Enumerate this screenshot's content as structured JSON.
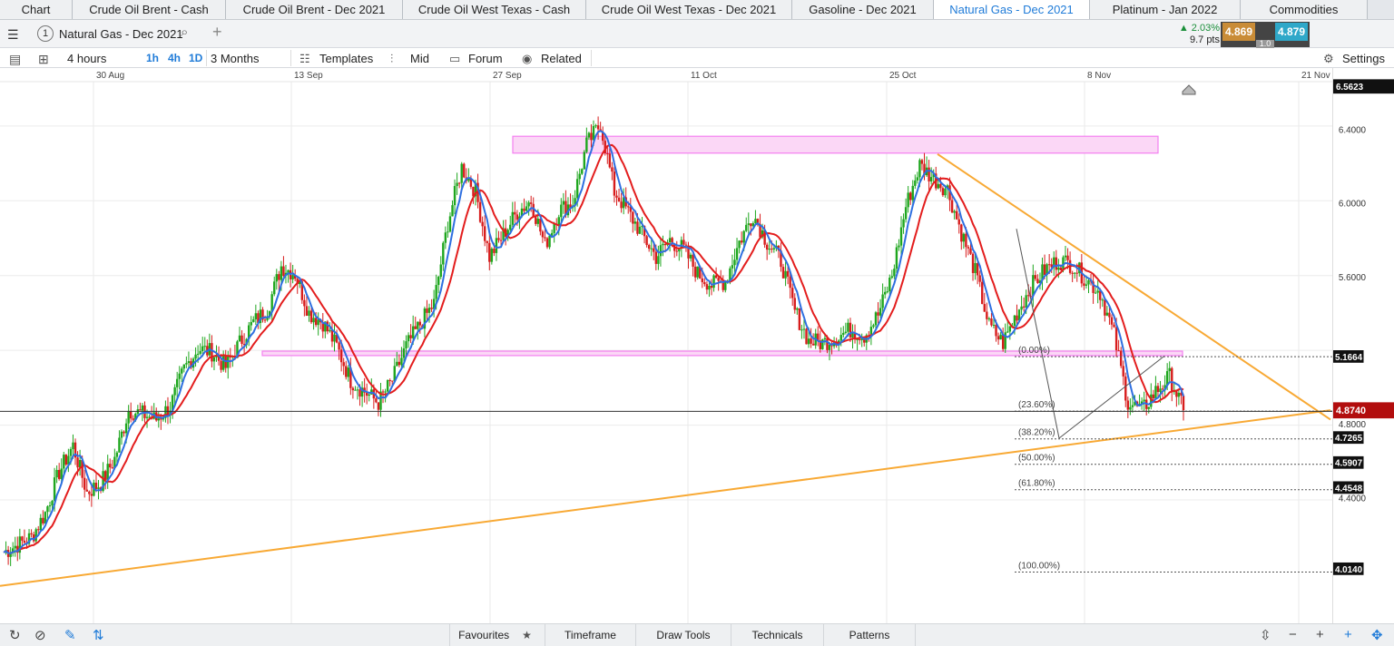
{
  "tabs": [
    {
      "label": "Chart",
      "active": false
    },
    {
      "label": "Crude Oil Brent - Cash",
      "active": false
    },
    {
      "label": "Crude Oil Brent - Dec 2021",
      "active": false
    },
    {
      "label": "Crude Oil West Texas - Cash",
      "active": false
    },
    {
      "label": "Crude Oil West Texas - Dec 2021",
      "active": false
    },
    {
      "label": "Gasoline - Dec 2021",
      "active": false
    },
    {
      "label": "Natural Gas - Dec 2021",
      "active": true
    },
    {
      "label": "Platinum - Jan 2022",
      "active": false
    },
    {
      "label": "Commodities",
      "active": false
    }
  ],
  "toolbar": {
    "layout_number": "1",
    "symbol": "Natural Gas - Dec 2021",
    "change_pct": "▲ 2.03%",
    "change_pts": "9.7 pts",
    "bid": "4.869",
    "ask": "4.879",
    "spread": "1.0"
  },
  "subtoolbar": {
    "interval": "4 hours",
    "tf_1h": "1h",
    "tf_4h": "4h",
    "tf_1d": "1D",
    "range": "3 Months",
    "templates": "Templates",
    "mid": "Mid",
    "forum": "Forum",
    "related": "Related",
    "settings": "Settings"
  },
  "bottom": {
    "favourites": "Favourites",
    "timeframe": "Timeframe",
    "draw_tools": "Draw Tools",
    "technicals": "Technicals",
    "patterns": "Patterns"
  },
  "colors": {
    "bull": "#1ea61e",
    "bear": "#d71c1c",
    "ma_fast": "#2e6fe0",
    "ma_slow": "#e31d1d",
    "trend": "#f8a934",
    "zone": "#f47ff0",
    "price_tag": "#b20d0d"
  },
  "chart_data": {
    "type": "candlestick",
    "instrument": "Natural Gas - Dec 2021",
    "interval": "4 hours",
    "x_ticks": [
      "30 Aug",
      "13 Sep",
      "27 Sep",
      "11 Oct",
      "25 Oct",
      "8 Nov",
      "21 Nov"
    ],
    "y_ticks": [
      "6.4000",
      "6.0000",
      "5.6000",
      "4.8000",
      "4.4000"
    ],
    "ylim": [
      3.74,
      6.71
    ],
    "last_price": "4.8740",
    "high_label": "6.5623",
    "fib_levels": [
      {
        "label": "(0.00%)",
        "value": "5.1664"
      },
      {
        "label": "(23.60%)",
        "value": ""
      },
      {
        "label": "(38.20%)",
        "value": "4.7265"
      },
      {
        "label": "(50.00%)",
        "value": "4.5907"
      },
      {
        "label": "(61.80%)",
        "value": "4.4548"
      },
      {
        "label": "(100.00%)",
        "value": "4.0140"
      }
    ],
    "series": [
      {
        "name": "",
        "kind": "ma_fast"
      },
      {
        "name": "",
        "kind": "ma_slow"
      }
    ],
    "closes": [
      4.12,
      4.16,
      4.2,
      4.33,
      4.55,
      4.69,
      4.44,
      4.49,
      4.62,
      4.88,
      4.86,
      4.83,
      4.9,
      5.1,
      5.21,
      5.19,
      5.11,
      5.24,
      5.35,
      5.42,
      5.65,
      5.61,
      5.4,
      5.35,
      5.22,
      5.04,
      4.98,
      4.92,
      5.04,
      5.22,
      5.34,
      5.45,
      5.88,
      6.18,
      6.05,
      5.7,
      5.82,
      5.94,
      6.0,
      5.76,
      5.95,
      5.99,
      6.3,
      6.41,
      6.05,
      5.94,
      5.82,
      5.7,
      5.79,
      5.74,
      5.61,
      5.55,
      5.57,
      5.78,
      5.93,
      5.78,
      5.68,
      5.41,
      5.25,
      5.24,
      5.27,
      5.31,
      5.28,
      5.39,
      5.6,
      5.97,
      6.19,
      6.12,
      6.06,
      5.83,
      5.62,
      5.33,
      5.24,
      5.4,
      5.54,
      5.63,
      5.68,
      5.66,
      5.58,
      5.51,
      5.28,
      4.92,
      4.88,
      4.98,
      5.06,
      4.88
    ]
  }
}
